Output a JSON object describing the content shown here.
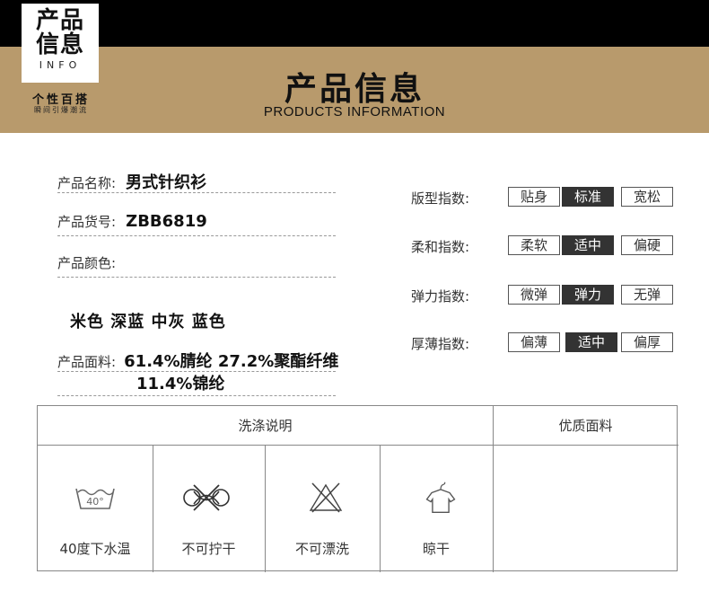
{
  "header": {
    "logo_line1": "产品",
    "logo_line2": "信息",
    "logo_en": "INFO",
    "tag_line1": "个性百搭",
    "tag_line2": "瞬间引爆潮流",
    "title": "产品信息",
    "subtitle": "PRODUCTS INFORMATION"
  },
  "product": {
    "name_label": "产品名称:",
    "name_value": "男式针织衫",
    "sku_label": "产品货号:",
    "sku_value": "ZBB6819",
    "color_label": "产品颜色:",
    "color_value": "米色 深蓝 中灰 蓝色",
    "fabric_label": "产品面料:",
    "fabric_line1": "61.4%腈纶 27.2%聚酯纤维",
    "fabric_line2": "11.4%锦纶"
  },
  "indices": [
    {
      "label": "版型指数:",
      "options": [
        "贴身",
        "标准",
        "宽松"
      ],
      "selected": 1
    },
    {
      "label": "柔和指数:",
      "options": [
        "柔软",
        "适中",
        "偏硬"
      ],
      "selected": 1
    },
    {
      "label": "弹力指数:",
      "options": [
        "微弹",
        "弹力",
        "无弹"
      ],
      "selected": 1
    },
    {
      "label": "厚薄指数:",
      "options": [
        "偏薄",
        "适中",
        "偏厚"
      ],
      "selected": 1
    }
  ],
  "wash": {
    "header": "洗涤说明",
    "quality_header": "优质面料",
    "icons": [
      {
        "icon": "wash-40-icon",
        "label": "40度下水温",
        "temp": "40°"
      },
      {
        "icon": "no-wring-icon",
        "label": "不可拧干"
      },
      {
        "icon": "no-bleach-icon",
        "label": "不可漂洗"
      },
      {
        "icon": "hang-dry-icon",
        "label": "晾干"
      }
    ]
  }
}
